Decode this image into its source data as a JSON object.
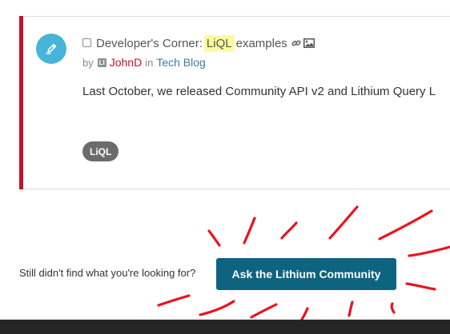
{
  "post": {
    "title_prefix": "Developer's Corner:",
    "title_highlight": "LiQL",
    "title_suffix": "examples",
    "title_icons": [
      "link-icon",
      "image-icon"
    ],
    "meta": {
      "by": "by",
      "rank_badge": "LI",
      "author": "JohnD",
      "in": "in",
      "board": "Tech Blog"
    },
    "excerpt": "Last October, we released Community API v2 and Lithium Query L",
    "tag": "LiQL",
    "icon": "pencil-icon"
  },
  "cta": {
    "prompt": "Still didn't find what you're looking for?",
    "button_label": "Ask the Lithium Community"
  },
  "colors": {
    "accent": "#c8102e",
    "post_icon_bg": "#46b5d9",
    "button_bg": "#0e6480",
    "highlight": "#fbfba0",
    "annotation": "#e8141e",
    "footer": "#262626"
  }
}
